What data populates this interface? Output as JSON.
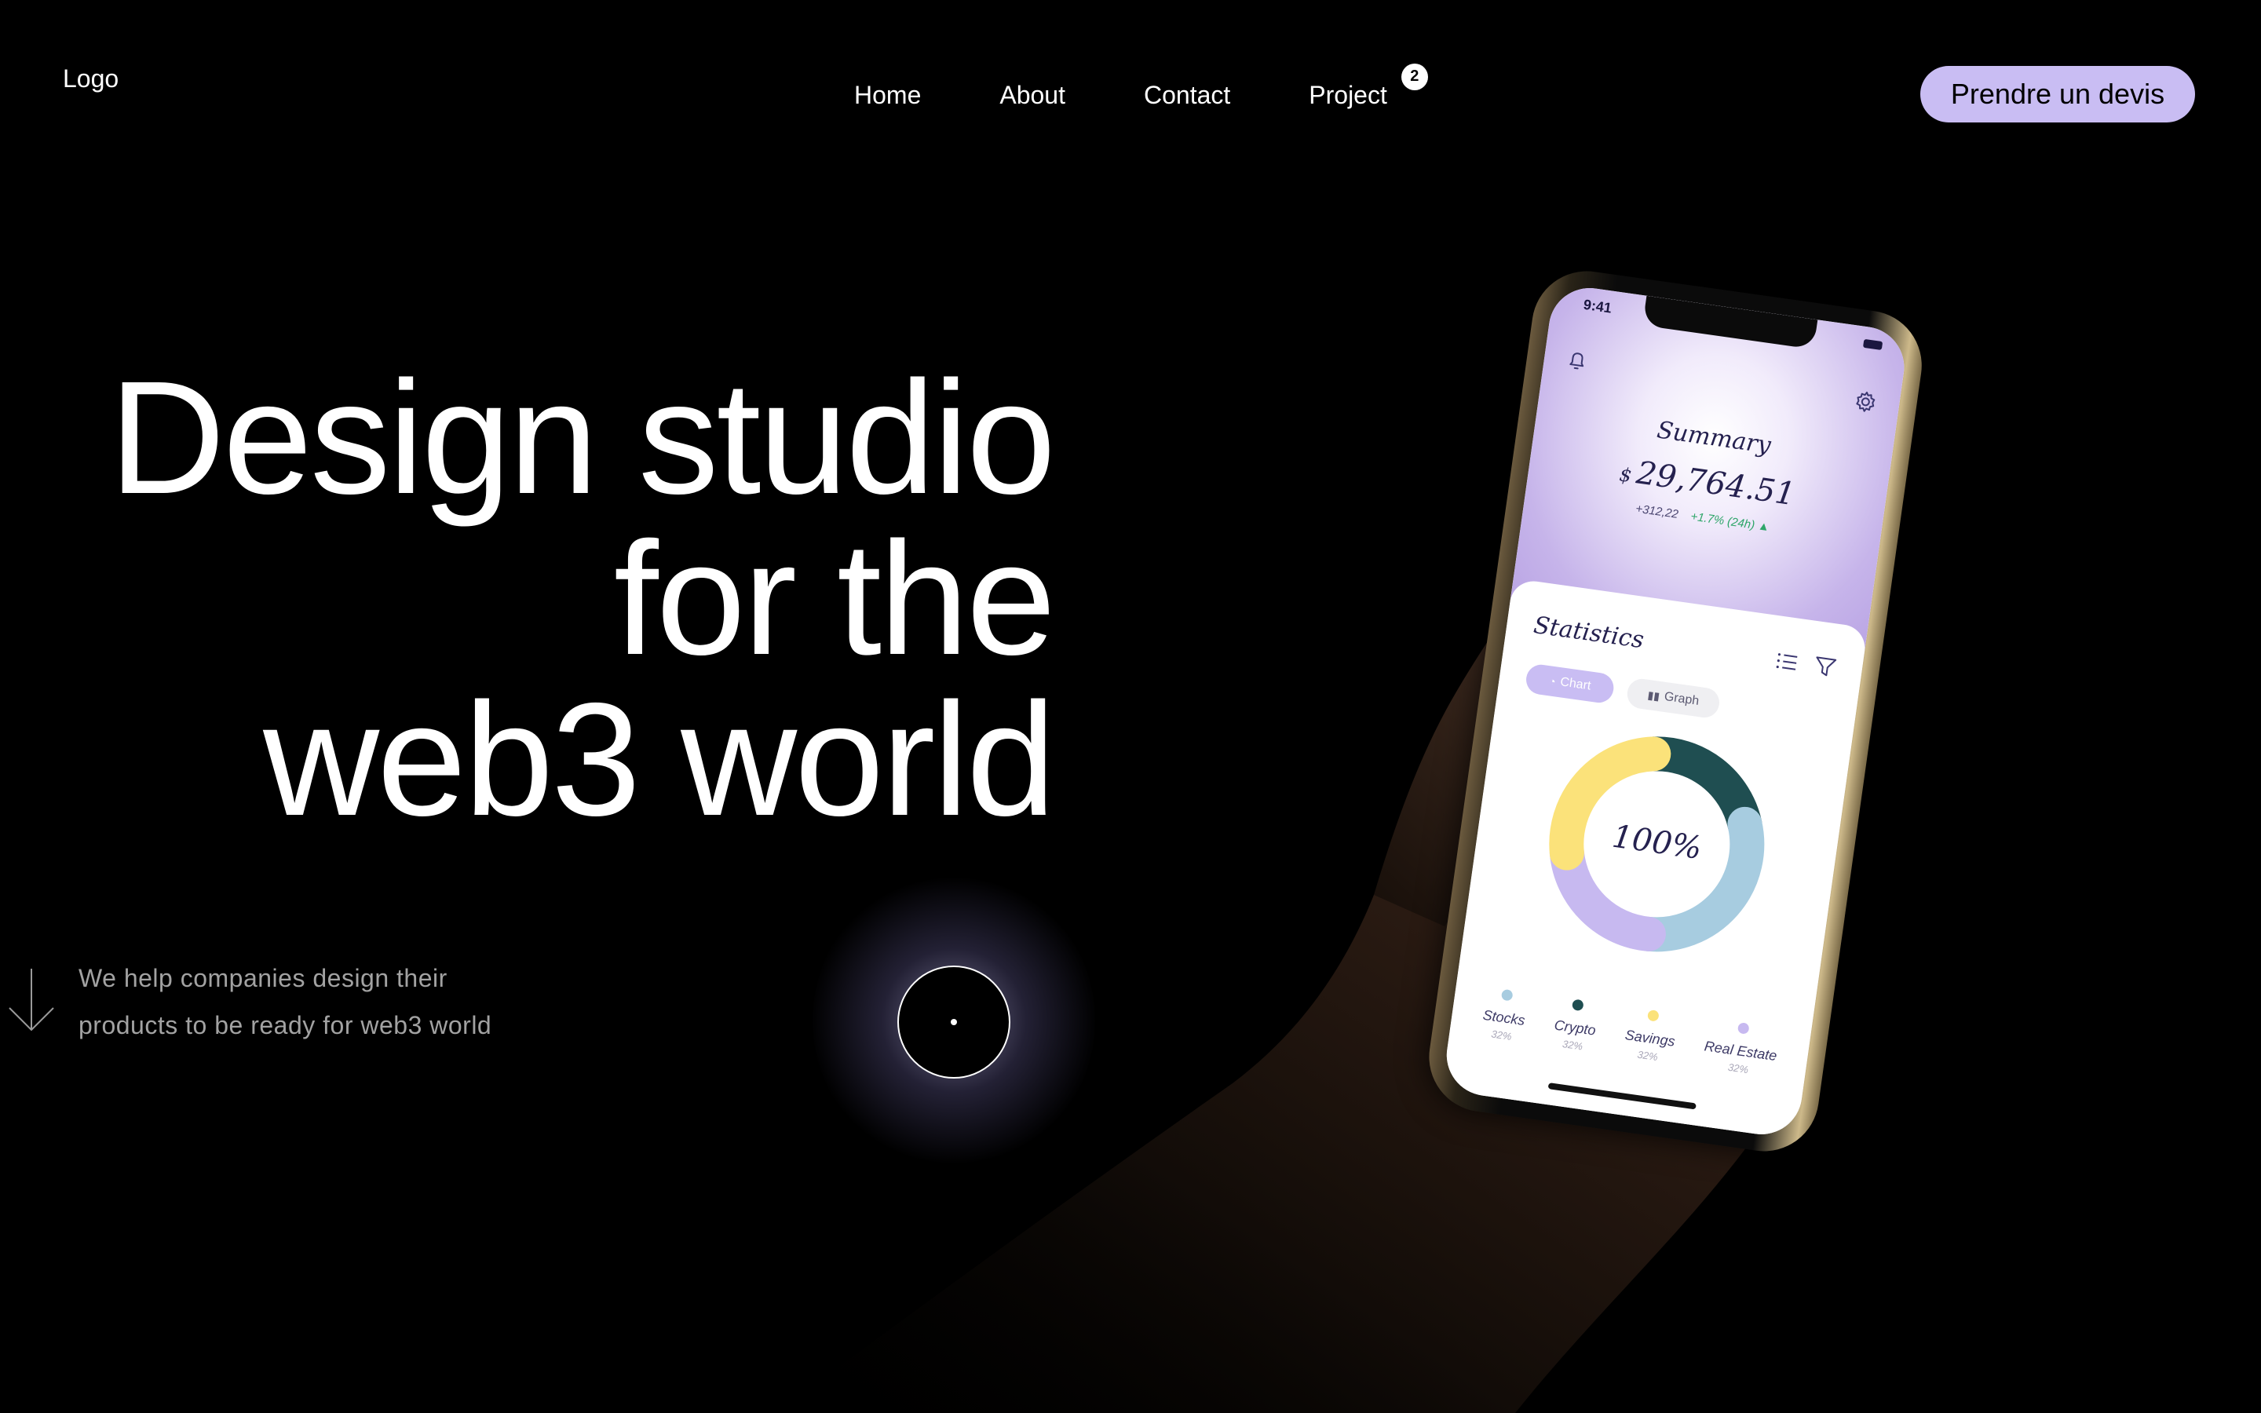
{
  "header": {
    "logo": "Logo",
    "nav": [
      {
        "label": "Home"
      },
      {
        "label": "About"
      },
      {
        "label": "Contact"
      },
      {
        "label": "Project",
        "badge": "2"
      }
    ],
    "cta_label": "Prendre un devis"
  },
  "hero": {
    "title_lines": [
      "Design studio",
      "for the",
      "web3 world"
    ],
    "subtext_lines": [
      "We help companies design their",
      "products to be ready for web3 world"
    ]
  },
  "phone": {
    "status_time": "9:41",
    "summary_title": "Summary",
    "summary_currency": "$",
    "summary_amount": "29,764.51",
    "summary_change_abs": "+312,22",
    "summary_change_pct": "+1.7% (24h) ▲",
    "stats_title": "Statistics",
    "segments": {
      "chart": "Chart",
      "graph": "Graph"
    },
    "donut_label": "100%",
    "donut_segments": [
      {
        "name": "Crypto",
        "fraction": 0.22,
        "color": "#1f4e51"
      },
      {
        "name": "Stocks",
        "fraction": 0.3,
        "color": "#a7cce0"
      },
      {
        "name": "Real Estate",
        "fraction": 0.22,
        "color": "#c7b9f0"
      },
      {
        "name": "Savings",
        "fraction": 0.26,
        "color": "#fbe27a"
      }
    ],
    "legend": [
      {
        "name": "Stocks",
        "pct": "32%",
        "color": "#a7cce0"
      },
      {
        "name": "Crypto",
        "pct": "32%",
        "color": "#1f4e51"
      },
      {
        "name": "Savings",
        "pct": "32%",
        "color": "#fbe27a"
      },
      {
        "name": "Real Estate",
        "pct": "32%",
        "color": "#c7b9f0"
      }
    ]
  },
  "colors": {
    "background": "#000000",
    "accent": "#c9bdf3",
    "text_muted": "#a2a2a2"
  }
}
